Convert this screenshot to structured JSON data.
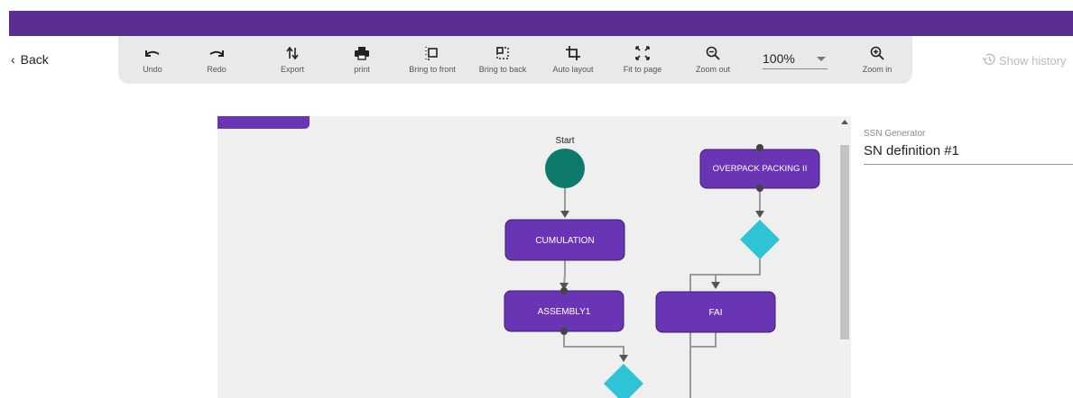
{
  "header": {
    "back_label": "Back"
  },
  "toolbar": {
    "tools": [
      {
        "label": "Undo",
        "icon": "undo-icon"
      },
      {
        "label": "Redo",
        "icon": "redo-icon"
      },
      {
        "label": "Export",
        "icon": "export-icon"
      },
      {
        "label": "print",
        "icon": "print-icon"
      },
      {
        "label": "Bring to front",
        "icon": "bring-to-front-icon"
      },
      {
        "label": "Bring to back",
        "icon": "bring-to-back-icon"
      },
      {
        "label": "Auto layout",
        "icon": "crop-icon"
      },
      {
        "label": "Fit to page",
        "icon": "fit-to-page-icon"
      },
      {
        "label": "Zoom out",
        "icon": "zoom-out-icon"
      },
      {
        "label": "Zoom in",
        "icon": "zoom-in-icon"
      }
    ],
    "zoom_value": "100%"
  },
  "history": {
    "label": "Show history",
    "icon": "history-icon"
  },
  "diagram": {
    "start_label": "Start",
    "nodes": {
      "cumulation": "CUMULATION",
      "assembly1": "ASSEMBLY1",
      "overpack": "OVERPACK PACKING II",
      "fai": "FAI"
    },
    "colors": {
      "node": "#6a35b5",
      "start": "#0d7b6c",
      "decision": "#2ec4d6",
      "header_bar": "#5a2d91"
    }
  },
  "properties": {
    "field_label": "SSN Generator",
    "field_value": "SN definition #1"
  }
}
